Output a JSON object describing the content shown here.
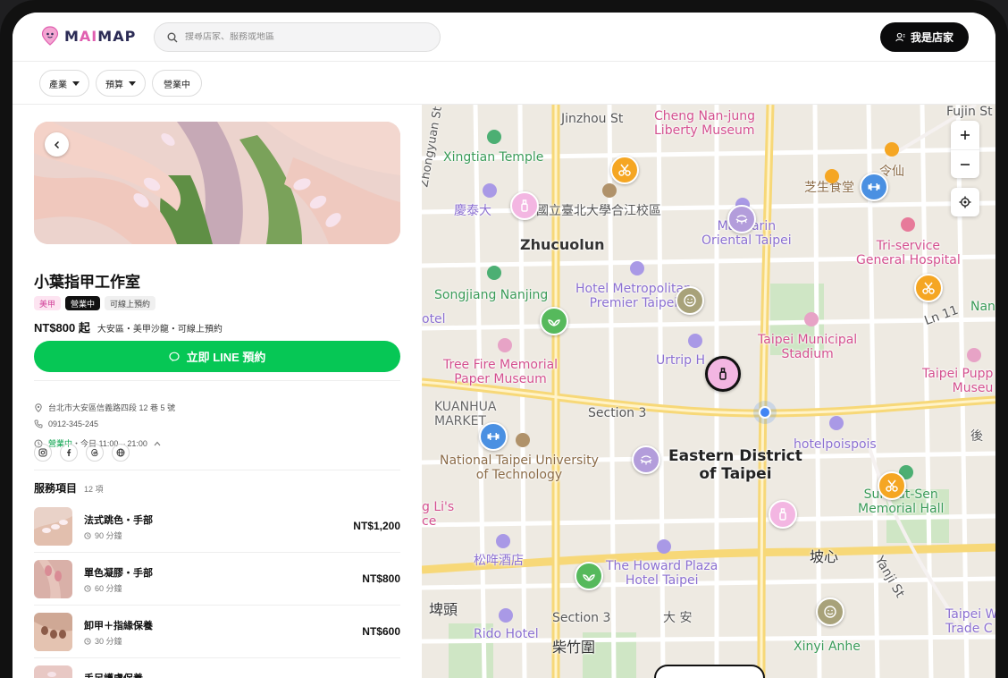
{
  "header": {
    "logo_text": "MAIMAP",
    "search_placeholder": "搜尋店家、服務或地區",
    "owner_button": "我是店家"
  },
  "filters": [
    {
      "label": "產業",
      "has_caret": true
    },
    {
      "label": "預算",
      "has_caret": true
    },
    {
      "label": "營業中",
      "has_caret": false
    }
  ],
  "store": {
    "name": "小葉指甲工作室",
    "tags": [
      "美甲",
      "營業中",
      "可線上預約"
    ],
    "price": "NT$800 起",
    "meta": "大安區・美甲沙龍・可線上預約",
    "line_button": "立即 LINE 預約",
    "address": "台北市大安區信義路四段 12 巷 5 號",
    "phone": "0912-345-245",
    "hours_status": "營業中",
    "hours_text": "・今日 11:00 – 21:00",
    "socials": [
      "instagram-icon",
      "facebook-icon",
      "threads-icon",
      "globe-icon"
    ]
  },
  "services": {
    "title": "服務項目",
    "count": "12 項",
    "items": [
      {
        "name": "法式跳色・手部",
        "duration": "90 分鐘",
        "price": "NT$1,200"
      },
      {
        "name": "單色凝膠・手部",
        "duration": "60 分鐘",
        "price": "NT$800"
      },
      {
        "name": "卸甲＋指緣保養",
        "duration": "30 分鐘",
        "price": "NT$600"
      },
      {
        "name": "手足護膚保養",
        "duration": "",
        "price": ""
      }
    ]
  },
  "map": {
    "labels": {
      "jinzhou": "Jinzhou St",
      "cheng": "Cheng Nan-jung\nLiberty Museum",
      "fujin": "Fujin St",
      "zhongyuan": "Zhongyuan St",
      "xingtian": "Xingtian Temple",
      "zhishi": "芝生食堂",
      "lingxian": "令仙",
      "qingtai": "慶泰大",
      "ntub": "國立臺北大學合江校區",
      "zhucuolun": "Zhucuolun",
      "mandarin": "Mandarin\nOriental Taipei",
      "triservice": "Tri-service\nGeneral Hospital",
      "songjiang": "Songjiang Nanjing",
      "metropolitan": "Hotel Metropolitan\nPremier Taipei",
      "ln11": "Ln 11",
      "nan": "Nan",
      "otel": "otel",
      "tree_fire": "Tree Fire Memorial\nPaper Museum",
      "urtrip": "Urtrip H",
      "stadium": "Taipei Municipal\nStadium",
      "puppet": "Taipei Pupp\nMuseu",
      "kuanhua": "KUANHUA\nMARKET",
      "section3a": "Section 3",
      "hotelpoispois": "hotelpoispois",
      "hou": "後",
      "ntut": "National Taipei University\nof Technology",
      "eastern": "Eastern District\nof Taipei",
      "sys": "Sun Yat-Sen\nMemorial Hall",
      "lilis": "g Li's\nce",
      "songnian": "松哖酒店",
      "howard": "The Howard Plaza\nHotel Taipei",
      "poxin": "坡心",
      "yanji": "Yanji St",
      "puding": "埤頭",
      "section3b": "Section 3",
      "daan": "大 安",
      "rido": "Rido Hotel",
      "chaizhu": "柴竹圍",
      "xinyi_anhe": "Xinyi Anhe",
      "taipei_trade": "Taipei W\nTrade C"
    },
    "accent": "#e05fb0",
    "colors": {
      "scissors": "#f5a623",
      "nail": "#f3b6e2",
      "spa": "#56b95c",
      "gym": "#4a90e2",
      "lash": "#b39ddb",
      "face": "#a8a27a"
    }
  }
}
